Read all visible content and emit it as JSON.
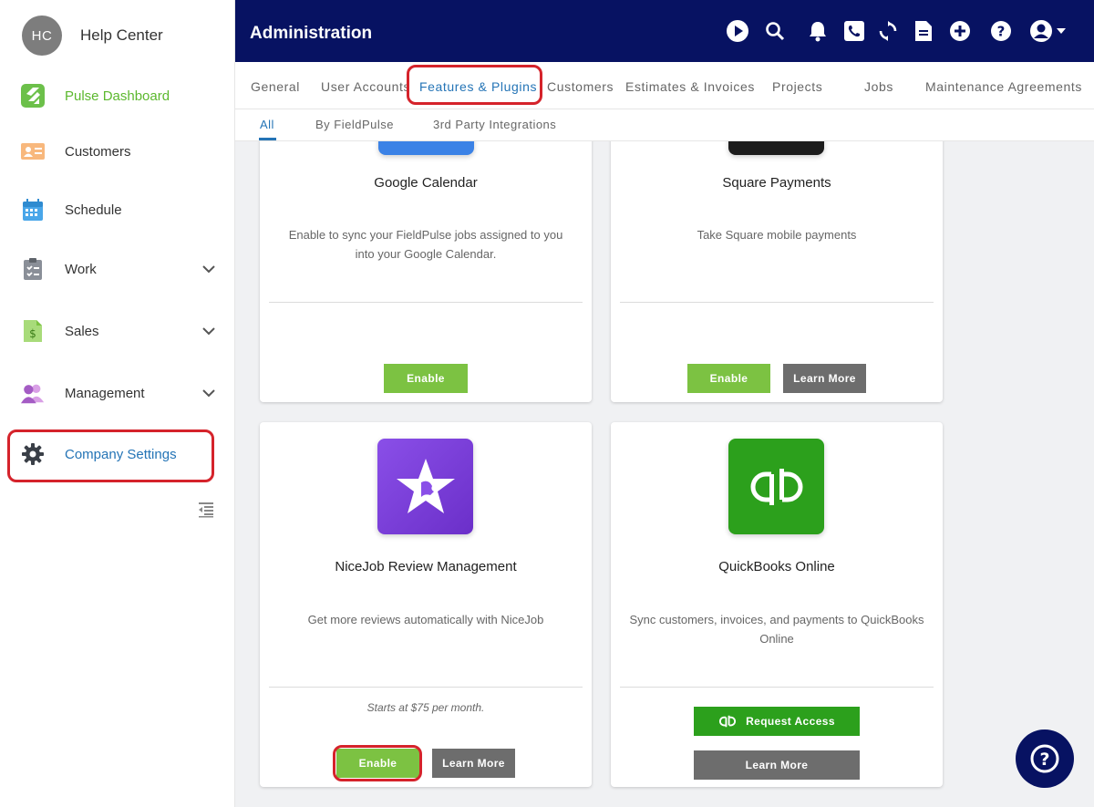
{
  "sidebar": {
    "user_initials": "HC",
    "user_name": "Help Center",
    "items": [
      {
        "label": "Pulse Dashboard",
        "icon": "pulse-logo-icon"
      },
      {
        "label": "Customers",
        "icon": "contact-card-icon"
      },
      {
        "label": "Schedule",
        "icon": "calendar-icon"
      },
      {
        "label": "Work",
        "icon": "clipboard-icon"
      },
      {
        "label": "Sales",
        "icon": "dollar-document-icon"
      },
      {
        "label": "Management",
        "icon": "users-icon"
      },
      {
        "label": "Company Settings",
        "icon": "gear-icon"
      }
    ]
  },
  "header": {
    "title": "Administration"
  },
  "tabs": [
    "General",
    "User Accounts",
    "Features & Plugins",
    "Customers",
    "Estimates & Invoices",
    "Projects",
    "Jobs",
    "Maintenance Agreements"
  ],
  "subtabs": [
    "All",
    "By FieldPulse",
    "3rd Party Integrations"
  ],
  "cards": [
    {
      "title": "Google Calendar",
      "description": "Enable to sync your FieldPulse jobs assigned to you into your Google Calendar.",
      "enable_label": "Enable"
    },
    {
      "title": "Square Payments",
      "description": "Take Square mobile payments",
      "enable_label": "Enable",
      "learn_label": "Learn More"
    },
    {
      "title": "NiceJob Review Management",
      "description": "Get more reviews automatically with NiceJob",
      "note": "Starts at $75 per month.",
      "enable_label": "Enable",
      "learn_label": "Learn More"
    },
    {
      "title": "QuickBooks Online",
      "description": "Sync customers, invoices, and payments to QuickBooks Online",
      "request_label": "Request Access",
      "learn_label": "Learn More"
    }
  ],
  "colors": {
    "navy": "#071262",
    "accent_green": "#7cc242",
    "link_blue": "#2474b6",
    "highlight_red": "#d5232b",
    "quickbooks_green": "#2ca01c",
    "nicejob_purple": "#7b3fd6"
  }
}
